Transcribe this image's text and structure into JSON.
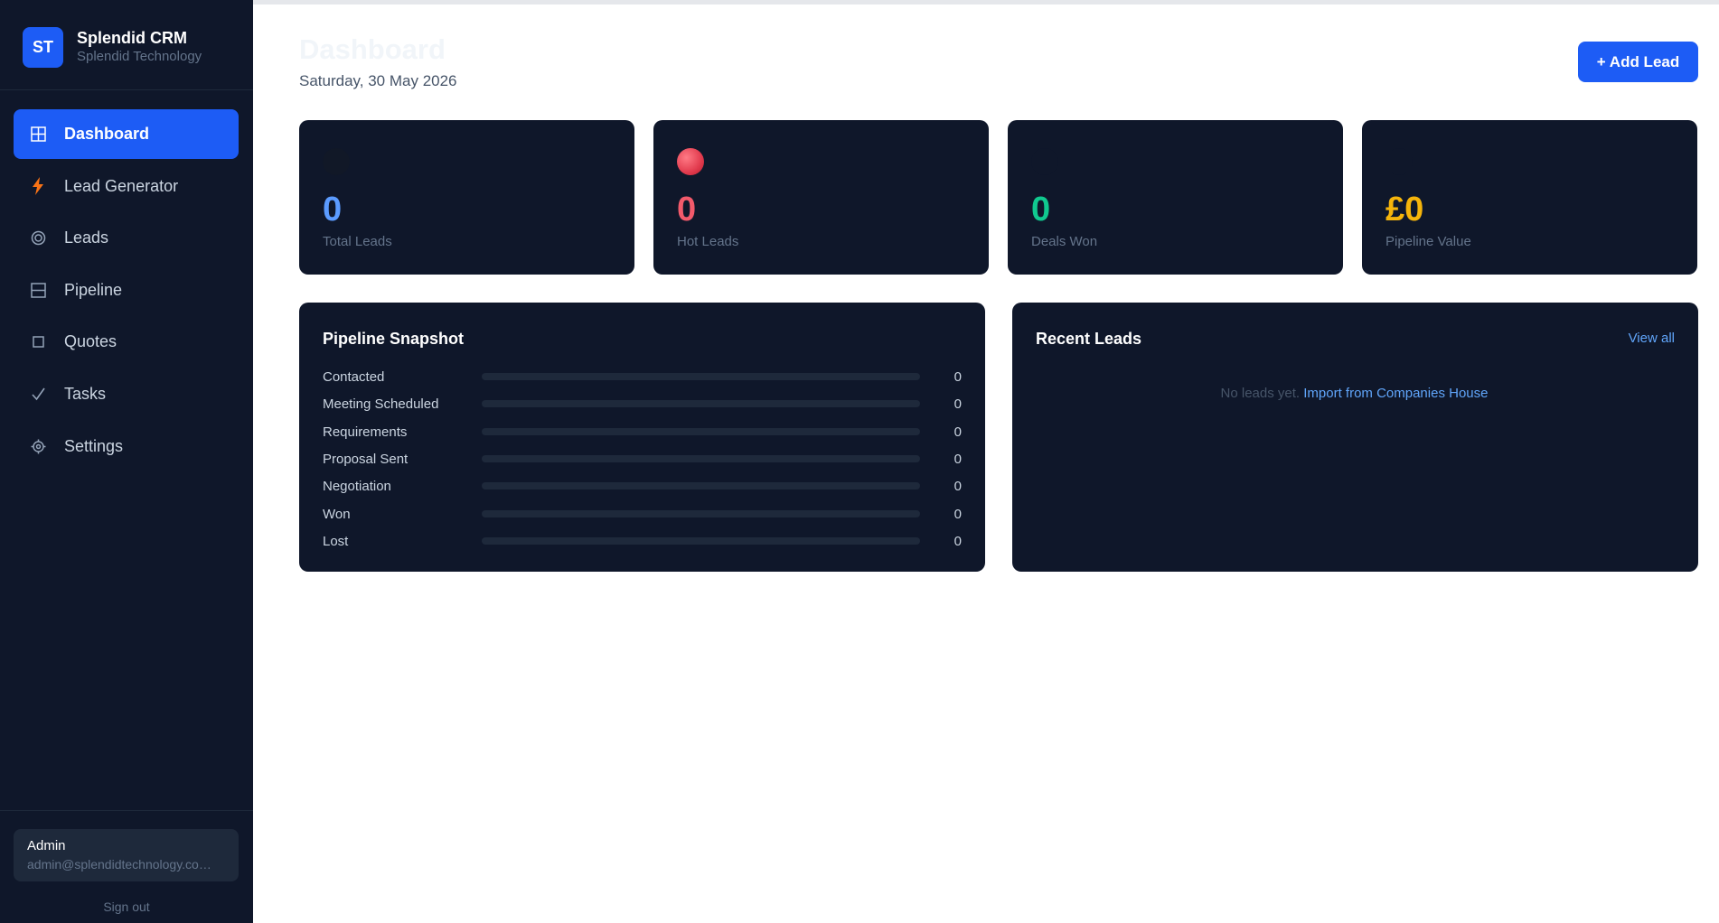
{
  "brand": {
    "initials": "ST",
    "title": "Splendid CRM",
    "subtitle": "Splendid Technology"
  },
  "nav": [
    {
      "label": "Dashboard",
      "icon": "grid-icon",
      "active": true
    },
    {
      "label": "Lead Generator",
      "icon": "lightning-icon"
    },
    {
      "label": "Leads",
      "icon": "target-icon"
    },
    {
      "label": "Pipeline",
      "icon": "columns-icon"
    },
    {
      "label": "Quotes",
      "icon": "square-icon"
    },
    {
      "label": "Tasks",
      "icon": "checkmark-icon"
    },
    {
      "label": "Settings",
      "icon": "gear-icon"
    }
  ],
  "user": {
    "name": "Admin",
    "email": "admin@splendidtechnology.co…",
    "signout": "Sign out"
  },
  "header": {
    "title": "Dashboard",
    "date": "Saturday, 30 May 2026",
    "add_button": "+ Add Lead"
  },
  "stats": [
    {
      "value": "0",
      "label": "Total Leads",
      "color": "#5b9bff"
    },
    {
      "value": "0",
      "label": "Hot Leads",
      "color": "#f25a6b"
    },
    {
      "value": "0",
      "label": "Deals Won",
      "color": "#10c98f"
    },
    {
      "value": "£0",
      "label": "Pipeline Value",
      "color": "#f5b40b"
    }
  ],
  "pipeline": {
    "title": "Pipeline Snapshot",
    "stages": [
      {
        "label": "Contacted",
        "count": "0",
        "fraction": 0
      },
      {
        "label": "Meeting Scheduled",
        "count": "0",
        "fraction": 0
      },
      {
        "label": "Requirements",
        "count": "0",
        "fraction": 0
      },
      {
        "label": "Proposal Sent",
        "count": "0",
        "fraction": 0
      },
      {
        "label": "Negotiation",
        "count": "0",
        "fraction": 0
      },
      {
        "label": "Won",
        "count": "0",
        "fraction": 0
      },
      {
        "label": "Lost",
        "count": "0",
        "fraction": 0
      }
    ]
  },
  "recent": {
    "title": "Recent Leads",
    "view_all": "View all",
    "empty_text": "No leads yet.",
    "import_link": "Import from Companies House"
  },
  "colors": {
    "accent": "#1d5cf5",
    "sidebar_bg": "#0f172a",
    "card_bg": "#0f172a",
    "hot_icon": "#e23b4e"
  }
}
